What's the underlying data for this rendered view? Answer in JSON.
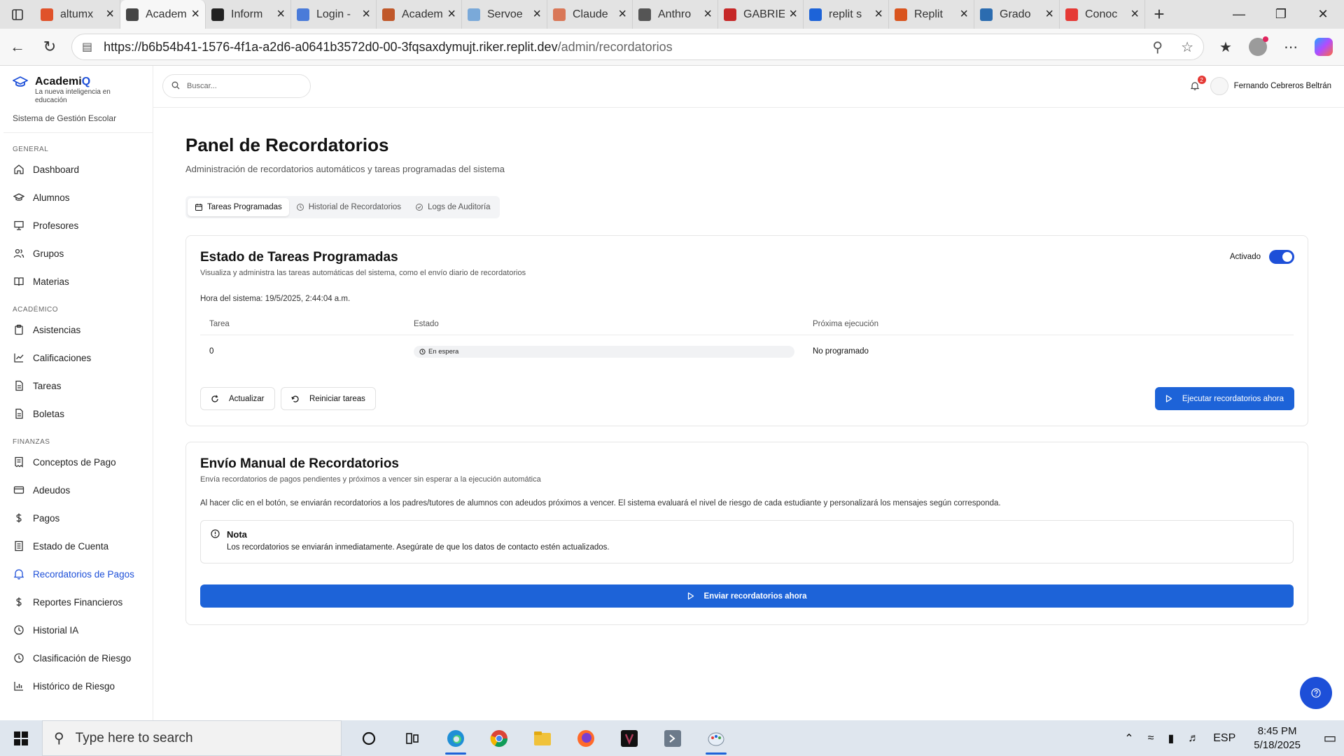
{
  "browser": {
    "tabs": [
      {
        "title": "altumx",
        "color": "#e0522a"
      },
      {
        "title": "Academ",
        "color": "#444444",
        "active": true
      },
      {
        "title": "Inform",
        "color": "#222222"
      },
      {
        "title": "Login -",
        "color": "#4a7bd9"
      },
      {
        "title": "Academ",
        "color": "#c0582a"
      },
      {
        "title": "Servoe",
        "color": "#7aa9d9"
      },
      {
        "title": "Claude",
        "color": "#d97757"
      },
      {
        "title": "Anthro",
        "color": "#555555"
      },
      {
        "title": "GABRIE",
        "color": "#c62828"
      },
      {
        "title": "replit s",
        "color": "#1d63d8"
      },
      {
        "title": "Replit",
        "color": "#d9541e"
      },
      {
        "title": "Grado",
        "color": "#2b6cb0"
      },
      {
        "title": "Conoc",
        "color": "#e53935"
      }
    ],
    "url": {
      "host": "https://b6b54b41-1576-4f1a-a2d6-a0641b3572d0-00-3fqsaxdymujt.riker.replit.dev",
      "path": "/admin/recordatorios"
    }
  },
  "brand": {
    "name_a": "Academi",
    "name_b": "Q",
    "tagline": "La nueva inteligencia en educación",
    "subtitle": "Sistema de Gestión Escolar"
  },
  "sidebar": {
    "sections": [
      {
        "title": "GENERAL",
        "items": [
          {
            "label": "Dashboard",
            "icon": "home-icon"
          },
          {
            "label": "Alumnos",
            "icon": "graduation-cap-icon"
          },
          {
            "label": "Profesores",
            "icon": "presentation-icon"
          },
          {
            "label": "Grupos",
            "icon": "users-icon"
          },
          {
            "label": "Materias",
            "icon": "book-icon"
          }
        ]
      },
      {
        "title": "ACADÉMICO",
        "items": [
          {
            "label": "Asistencias",
            "icon": "clipboard-icon"
          },
          {
            "label": "Calificaciones",
            "icon": "chart-line-icon"
          },
          {
            "label": "Tareas",
            "icon": "file-icon"
          },
          {
            "label": "Boletas",
            "icon": "file-icon"
          }
        ]
      },
      {
        "title": "FINANZAS",
        "items": [
          {
            "label": "Conceptos de Pago",
            "icon": "receipt-icon"
          },
          {
            "label": "Adeudos",
            "icon": "credit-card-icon"
          },
          {
            "label": "Pagos",
            "icon": "dollar-icon"
          },
          {
            "label": "Estado de Cuenta",
            "icon": "ledger-icon"
          },
          {
            "label": "Recordatorios de Pagos",
            "icon": "bell-icon",
            "active": true
          },
          {
            "label": "Reportes Financieros",
            "icon": "dollar-icon"
          },
          {
            "label": "Historial IA",
            "icon": "history-icon"
          },
          {
            "label": "Clasificación de Riesgo",
            "icon": "history-icon"
          },
          {
            "label": "Histórico de Riesgo",
            "icon": "bar-chart-icon"
          }
        ]
      }
    ]
  },
  "topbar": {
    "search_placeholder": "Buscar...",
    "notification_count": "2",
    "user_name": "Fernando Cebreros Beltrán"
  },
  "page": {
    "title": "Panel de Recordatorios",
    "description": "Administración de recordatorios automáticos y tareas programadas del sistema",
    "tabs": [
      {
        "label": "Tareas Programadas",
        "icon": "calendar-icon",
        "active": true
      },
      {
        "label": "Historial de Recordatorios",
        "icon": "clock-icon"
      },
      {
        "label": "Logs de Auditoría",
        "icon": "check-circle-icon"
      }
    ]
  },
  "scheduled": {
    "title": "Estado de Tareas Programadas",
    "description": "Visualiza y administra las tareas automáticas del sistema, como el envío diario de recordatorios",
    "toggle_label": "Activado",
    "toggle_on": true,
    "system_time_label": "Hora del sistema:",
    "system_time": "19/5/2025, 2:44:04 a.m.",
    "columns": [
      "Tarea",
      "Estado",
      "Próxima ejecución"
    ],
    "rows": [
      {
        "task": "0",
        "status": "En espera",
        "next": "No programado"
      }
    ],
    "buttons": {
      "refresh": "Actualizar",
      "restart": "Reiniciar tareas",
      "run_now": "Ejecutar recordatorios ahora"
    }
  },
  "manual": {
    "title": "Envío Manual de Recordatorios",
    "description": "Envía recordatorios de pagos pendientes y próximos a vencer sin esperar a la ejecución automática",
    "info": "Al hacer clic en el botón, se enviarán recordatorios a los padres/tutores de alumnos con adeudos próximos a vencer. El sistema evaluará el nivel de riesgo de cada estudiante y personalizará los mensajes según corresponda.",
    "note_title": "Nota",
    "note_body": "Los recordatorios se enviarán inmediatamente. Asegúrate de que los datos de contacto estén actualizados.",
    "send_button": "Enviar recordatorios ahora"
  },
  "taskbar": {
    "search_placeholder": "Type here to search",
    "language": "ESP",
    "time": "8:45 PM",
    "date": "5/18/2025"
  },
  "colors": {
    "accent": "#1d63d8",
    "brand": "#1d4fd8"
  }
}
